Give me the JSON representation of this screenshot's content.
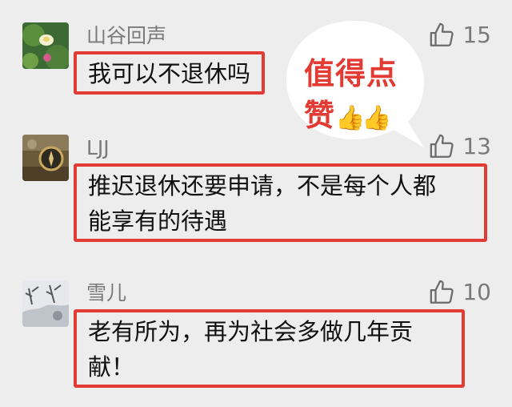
{
  "comments": [
    {
      "username": "山谷回声",
      "likes": "15",
      "text_lines": [
        "我可以不退休吗"
      ]
    },
    {
      "username": "LJJ",
      "likes": "13",
      "text_lines": [
        "推迟退休还要申请，不是每个人都",
        "能享有的待遇"
      ]
    },
    {
      "username": "雪儿",
      "likes": "10",
      "text_lines": [
        "老有所为，再为社会多做几年贡",
        "献！"
      ]
    }
  ],
  "callout": {
    "line1": "值得点",
    "line2": "赞",
    "emoji": "👍👍"
  },
  "colors": {
    "background": "#ededed",
    "highlight_border": "#e23b33",
    "callout_text": "#e23b33",
    "meta_text": "#7a7a7a"
  },
  "icons": {
    "like": "thumbs-up-outline-icon",
    "callout_emoji": "thumbs-up-emoji"
  }
}
